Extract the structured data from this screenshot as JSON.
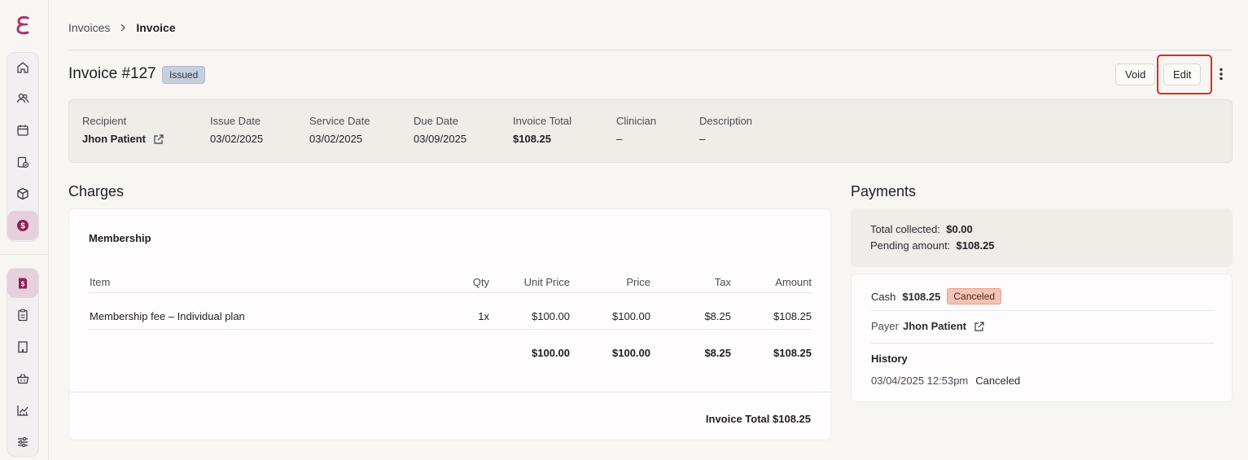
{
  "breadcrumb": {
    "parent": "Invoices",
    "current": "Invoice"
  },
  "invoice": {
    "title": "Invoice #127",
    "status": "Issued",
    "actions": {
      "void": "Void",
      "edit": "Edit"
    }
  },
  "summary": {
    "recipient": {
      "label": "Recipient",
      "value": "Jhon Patient"
    },
    "issue_date": {
      "label": "Issue Date",
      "value": "03/02/2025"
    },
    "service_date": {
      "label": "Service Date",
      "value": "03/02/2025"
    },
    "due_date": {
      "label": "Due Date",
      "value": "03/09/2025"
    },
    "invoice_total": {
      "label": "Invoice Total",
      "value": "$108.25"
    },
    "clinician": {
      "label": "Clinician",
      "value": "–"
    },
    "description": {
      "label": "Description",
      "value": "–"
    }
  },
  "charges": {
    "title": "Charges",
    "group": "Membership",
    "columns": {
      "item": "Item",
      "qty": "Qty",
      "unit_price": "Unit Price",
      "price": "Price",
      "tax": "Tax",
      "amount": "Amount"
    },
    "row": {
      "item": "Membership fee – Individual plan",
      "qty": "1x",
      "unit_price": "$100.00",
      "price": "$100.00",
      "tax": "$8.25",
      "amount": "$108.25"
    },
    "totals": {
      "unit_price": "$100.00",
      "price": "$100.00",
      "tax": "$8.25",
      "amount": "$108.25"
    },
    "invoice_total": "Invoice Total $108.25"
  },
  "payments": {
    "title": "Payments",
    "total_collected_label": "Total collected:",
    "total_collected": "$0.00",
    "pending_label": "Pending amount:",
    "pending": "$108.25",
    "method": "Cash",
    "amount": "$108.25",
    "status": "Canceled",
    "payer_label": "Payer",
    "payer": "Jhon Patient",
    "history_title": "History",
    "history": {
      "timestamp": "03/04/2025 12:53pm",
      "event": "Canceled"
    }
  },
  "colors": {
    "brand": "#a8336f",
    "active_nav": "#e6d0dd",
    "highlight": "#e0281f"
  },
  "icons": [
    "logo-icon",
    "home-icon",
    "users-icon",
    "calendar-icon",
    "clipboard-check-icon",
    "box-icon",
    "dollar-icon",
    "invoice-icon",
    "clipboard-icon",
    "building-icon",
    "basket-icon",
    "chart-icon",
    "sliders-icon",
    "external-link-icon",
    "more-vertical-icon",
    "chevron-right-icon"
  ]
}
